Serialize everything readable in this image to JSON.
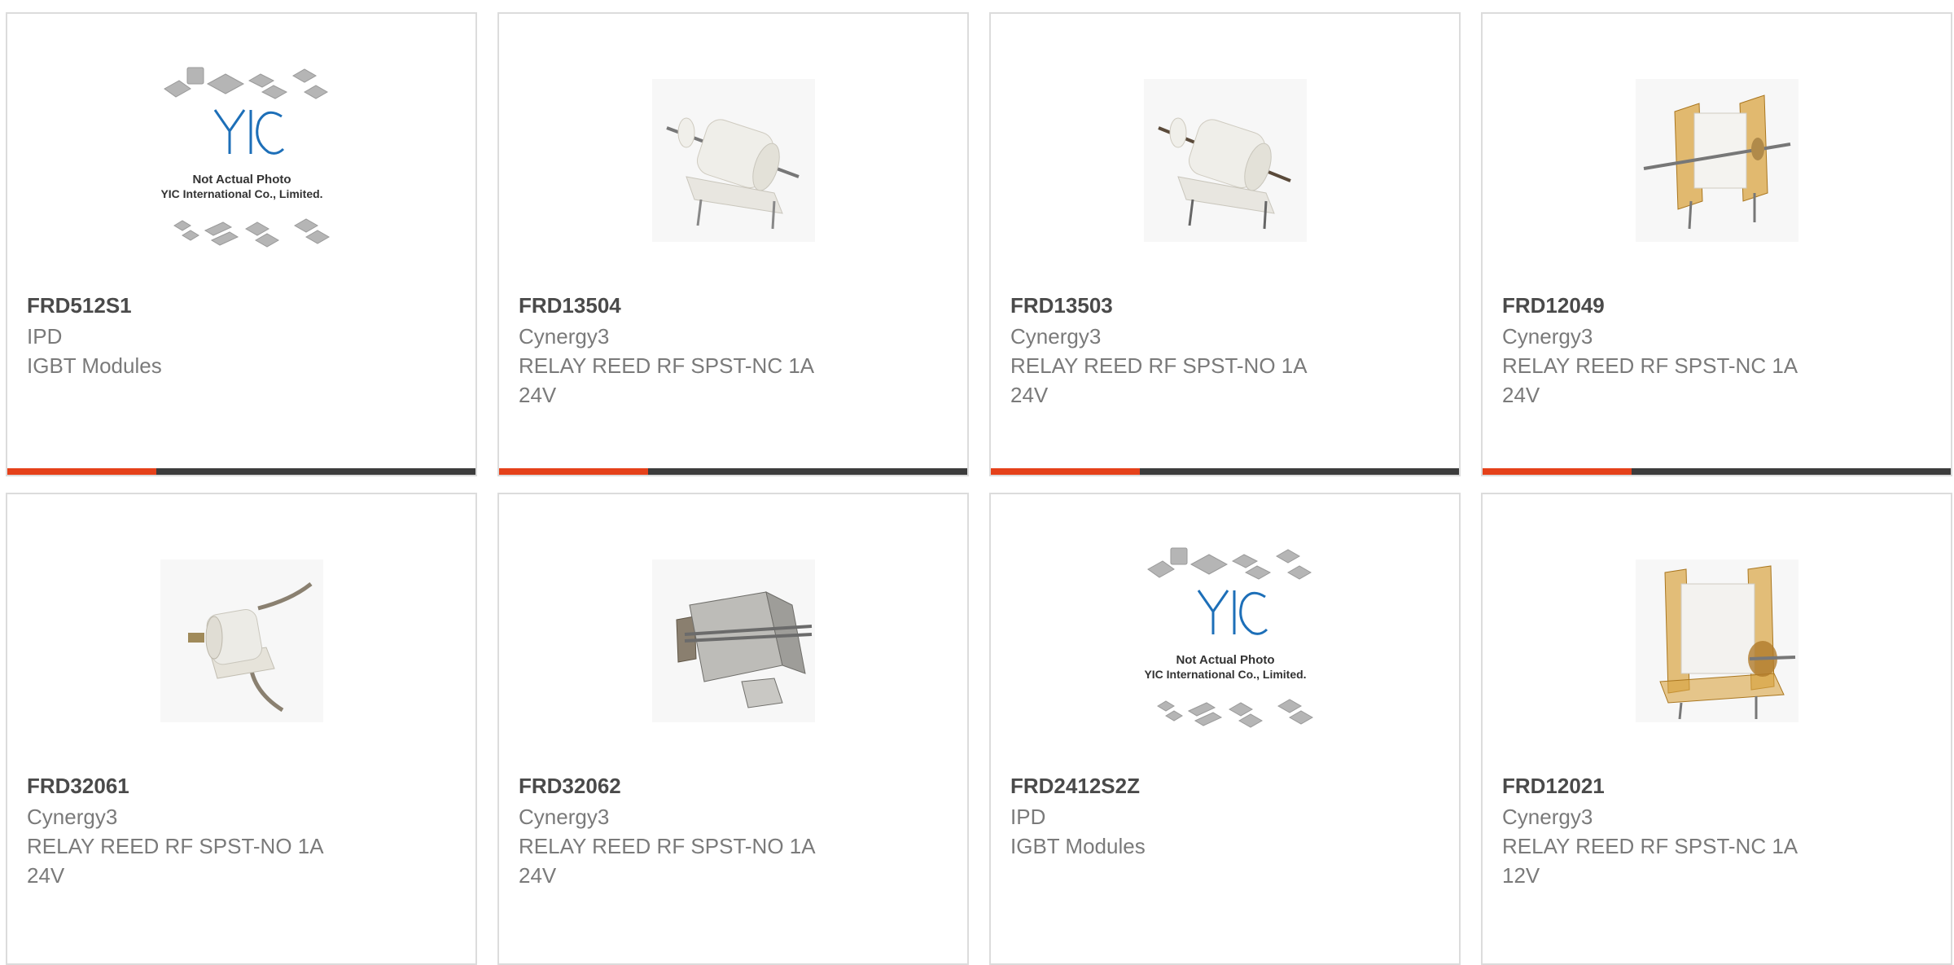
{
  "colors": {
    "accent": "#e5411a",
    "bar": "#3c3c3c",
    "border": "#dcdcdc",
    "part_number": "#4a4a4a",
    "text": "#7a7a7a"
  },
  "placeholder": {
    "line1": "Not Actual Photo",
    "line2": "YIC International Co., Limited.",
    "logo": "YIC"
  },
  "products": [
    {
      "part": "FRD512S1",
      "brand": "IPD",
      "desc1": "IGBT Modules",
      "desc2": "",
      "image": "placeholder-logo"
    },
    {
      "part": "FRD13504",
      "brand": "Cynergy3",
      "desc1": "RELAY REED RF SPST-NC 1A",
      "desc2": "24V",
      "image": "reed-relay-white"
    },
    {
      "part": "FRD13503",
      "brand": "Cynergy3",
      "desc1": "RELAY REED RF SPST-NO 1A",
      "desc2": "24V",
      "image": "reed-relay-white"
    },
    {
      "part": "FRD12049",
      "brand": "Cynergy3",
      "desc1": "RELAY REED RF SPST-NC 1A",
      "desc2": "24V",
      "image": "reed-relay-amber"
    },
    {
      "part": "FRD32061",
      "brand": "Cynergy3",
      "desc1": "RELAY REED RF SPST-NO 1A",
      "desc2": "24V",
      "image": "reed-relay-leads"
    },
    {
      "part": "FRD32062",
      "brand": "Cynergy3",
      "desc1": "RELAY REED RF SPST-NO 1A",
      "desc2": "24V",
      "image": "reed-relay-metal"
    },
    {
      "part": "FRD2412S2Z",
      "brand": "IPD",
      "desc1": "IGBT Modules",
      "desc2": "",
      "image": "placeholder-logo"
    },
    {
      "part": "FRD12021",
      "brand": "Cynergy3",
      "desc1": "RELAY REED RF SPST-NC 1A",
      "desc2": "12V",
      "image": "reed-relay-amber"
    }
  ]
}
